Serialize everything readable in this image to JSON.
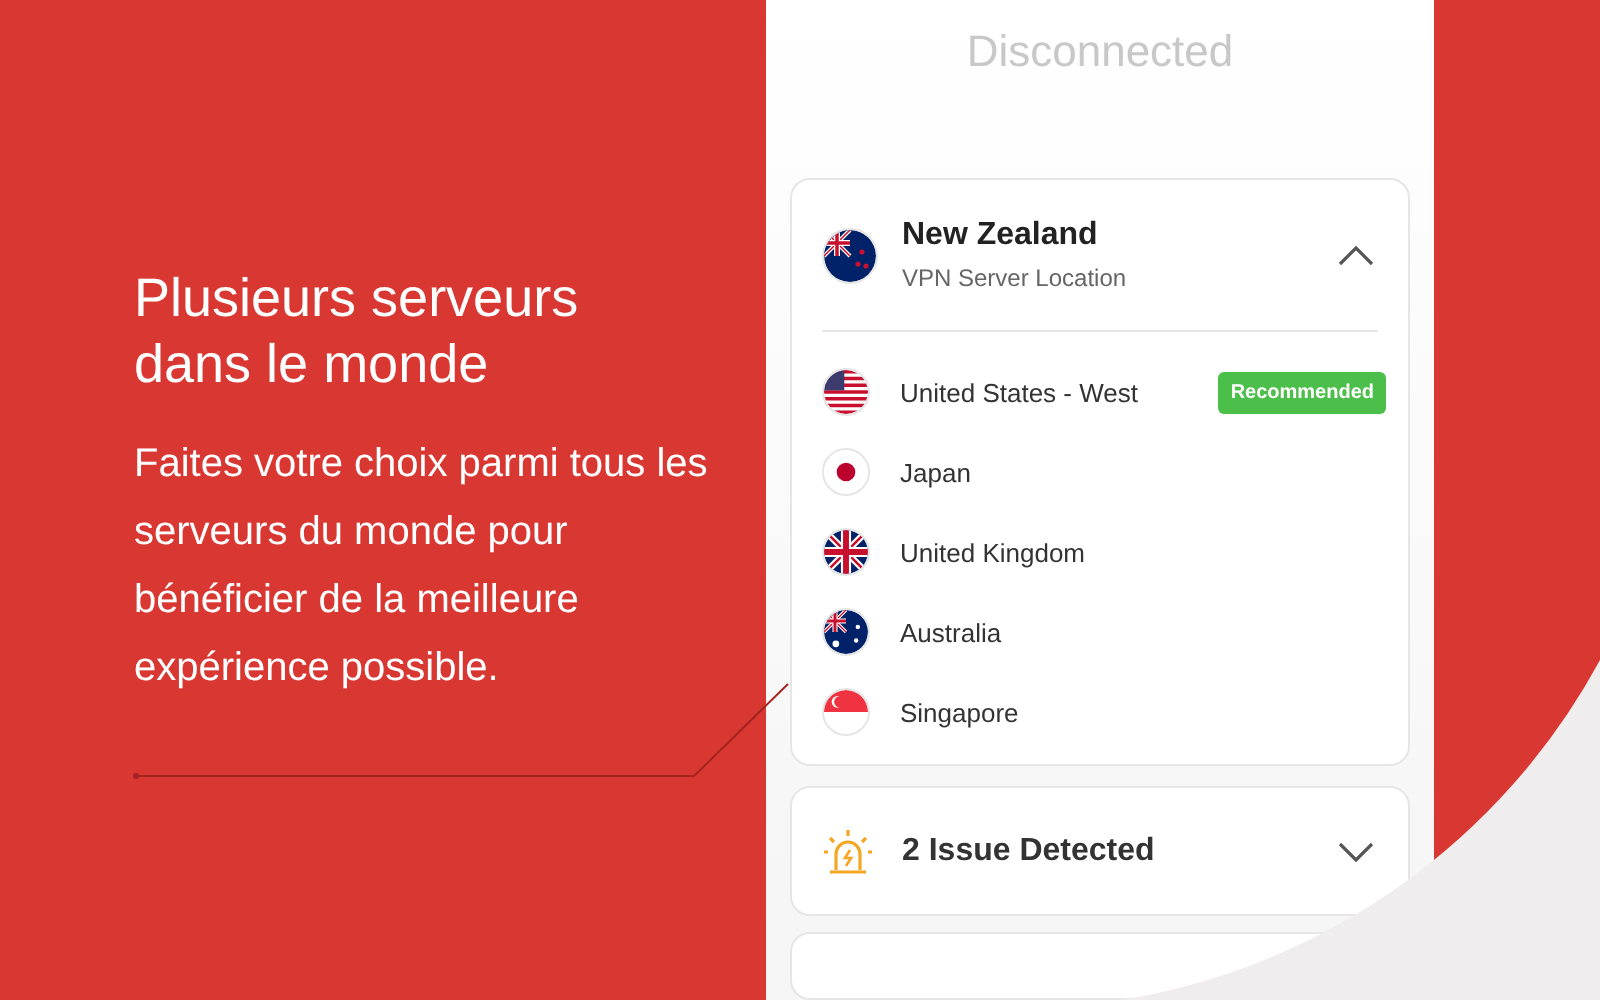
{
  "promo": {
    "heading": "Plusieurs serveurs dans le monde",
    "description": "Faites votre choix parmi tous les serveurs du monde pour bénéficier de la meilleure expérience possible."
  },
  "status": "Disconnected",
  "location_card": {
    "title": "New Zealand",
    "subtitle": "VPN Server Location",
    "expanded": true,
    "servers": [
      {
        "name": "United States - West",
        "badge": "Recommended"
      },
      {
        "name": "Japan"
      },
      {
        "name": "United Kingdom"
      },
      {
        "name": "Australia"
      },
      {
        "name": "Singapore"
      }
    ]
  },
  "issue_card": {
    "title": "2 Issue Detected",
    "expanded": false
  }
}
